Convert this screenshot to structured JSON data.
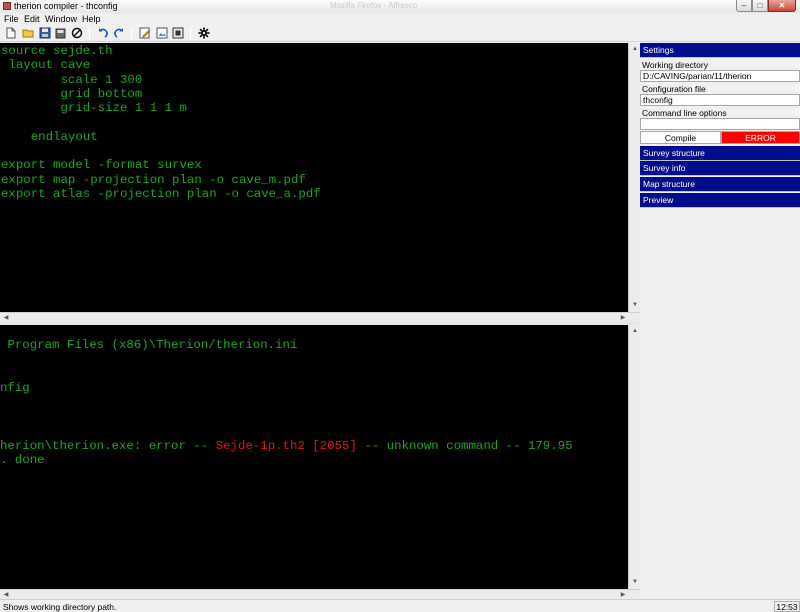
{
  "window": {
    "title": "therion compiler - thconfig",
    "ghost_title": "Mozilla Firefox - Alfresco",
    "minimize_glyph": "–",
    "maximize_glyph": "□",
    "close_glyph": "✕"
  },
  "menu": [
    "File",
    "Edit",
    "Window",
    "Help"
  ],
  "toolbar": {
    "icons": [
      "new-file-icon",
      "open-folder-icon",
      "save-icon",
      "save-all-icon",
      "stop-icon",
      "undo-icon",
      "redo-icon",
      "edit-icon",
      "image-icon",
      "compile-icon",
      "gear-icon"
    ]
  },
  "editor": {
    "lines": [
      "source sejde.th",
      " layout cave",
      "        scale 1 300",
      "        grid bottom",
      "        grid-size 1 1 1 m",
      "",
      "    endlayout",
      "",
      "export model -format survex",
      "export map -projection plan -o cave_m.pdf",
      "export atlas -projection plan -o cave_a.pdf"
    ]
  },
  "log": {
    "line1": " Program Files (x86)\\Therion/therion.ini",
    "line2": "nfig",
    "line3_prefix": "herion\\therion.exe: error -- ",
    "line3_error": "Sejde-1p.th2 [2055]",
    "line3_suffix": " -- unknown command -- 179.95",
    "line4": ". done"
  },
  "panel": {
    "settings_label": "Settings",
    "working_dir_label": "Working directory",
    "working_dir_value": "D:/CAVING/parian/11/therion",
    "config_label": "Configuration file",
    "config_value": "thconfig",
    "cmd_label": "Command line options",
    "cmd_value": "",
    "compile_label": "Compile",
    "status_label": "ERROR",
    "status_color": "#ff0000",
    "sections": [
      "Survey structure",
      "Survey info",
      "Map structure",
      "Preview"
    ],
    "header_color": "#000e8e"
  },
  "statusbar": {
    "message": "Shows working directory path.",
    "clock": "12:53"
  }
}
